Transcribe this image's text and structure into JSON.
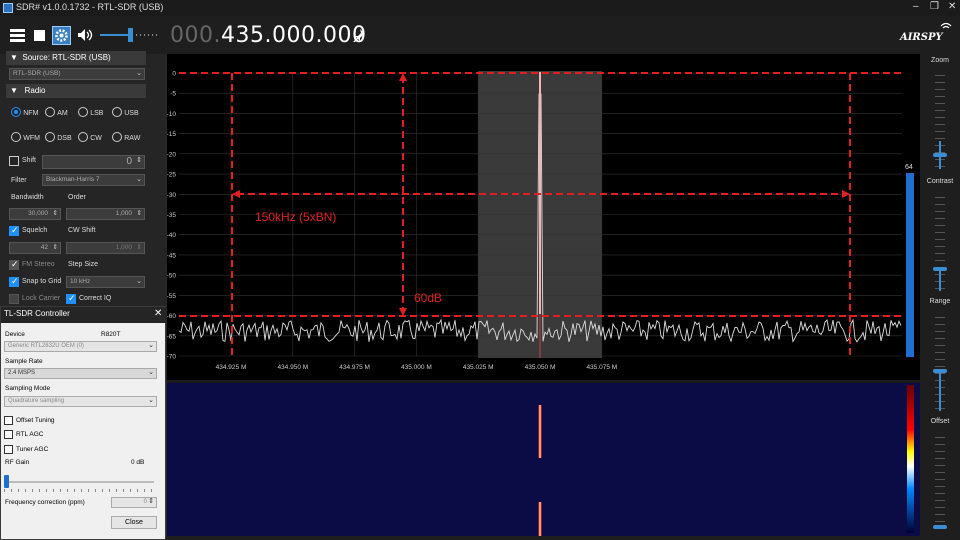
{
  "window": {
    "title": "SDR# v1.0.0.1732 - RTL-SDR (USB)",
    "minimize": "–",
    "maximize": "❐",
    "close": "✕"
  },
  "toolbar": {
    "freq_prefix": "000.",
    "freq_main": "435.000.000",
    "brand": "AIRSPY"
  },
  "sidebar": {
    "source_header": "Source: RTL-SDR (USB)",
    "source_value": "RTL-SDR (USB)",
    "radio_header": "Radio",
    "modes": [
      "NFM",
      "AM",
      "LSB",
      "USB",
      "WFM",
      "DSB",
      "CW",
      "RAW"
    ],
    "selected_mode": "NFM",
    "shift_label": "Shift",
    "shift_value": "0",
    "filter_label": "Filter",
    "filter_value": "Blackman-Harris 7",
    "bandwidth_label": "Bandwidth",
    "order_label": "Order",
    "bandwidth_value": "30,000",
    "order_value": "1,000",
    "squelch_label": "Squelch",
    "cw_shift_label": "CW Shift",
    "squelch_value": "42",
    "cw_shift_value": "1,000",
    "fm_stereo_label": "FM Stereo",
    "step_size_label": "Step Size",
    "snap_label": "Snap to Grid",
    "step_value": "10 kHz",
    "lock_carrier_label": "Lock Carrier",
    "correct_iq_label": "Correct IQ"
  },
  "dialog": {
    "title": "TL-SDR Controller",
    "device_label": "Device",
    "device_value": "R820T",
    "device_select": "Generic RTL2832U OEM (0)",
    "sample_rate_label": "Sample Rate",
    "sample_rate_value": "2.4 MSPS",
    "sampling_mode_label": "Sampling Mode",
    "sampling_mode_value": "Quadrature sampling",
    "offset_tuning": "Offset Tuning",
    "rtl_agc": "RTL AGC",
    "tuner_agc": "Tuner AGC",
    "rf_gain_label": "RF Gain",
    "rf_gain_value": "0 dB",
    "freq_corr_label": "Frequency correction (ppm)",
    "freq_corr_value": "0",
    "close_label": "Close"
  },
  "right_panel": {
    "zoom": "Zoom",
    "contrast": "Contrast",
    "range": "Range",
    "offset": "Offset",
    "level": "64"
  },
  "spectrum": {
    "y_ticks": [
      "0",
      "-5",
      "-10",
      "-15",
      "-20",
      "-25",
      "-30",
      "-35",
      "-40",
      "-45",
      "-50",
      "-55",
      "-60",
      "-65",
      "-70"
    ],
    "x_ticks": [
      "434.925 M",
      "434.950 M",
      "434.975 M",
      "435.000 M",
      "435.025 M",
      "435.050 M",
      "435.075 M"
    ],
    "annotation_bw": "150kHz (5xBN)",
    "annotation_db": "60dB",
    "annotation_color": "#e02020"
  }
}
